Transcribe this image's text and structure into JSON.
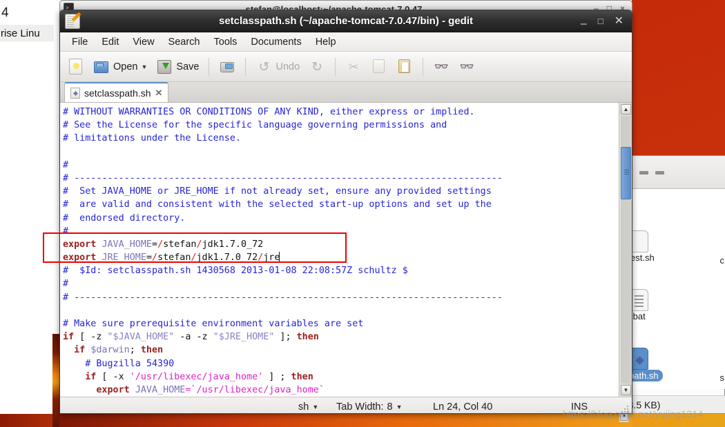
{
  "desktop": {
    "background_window_left": {
      "line1": "4",
      "line2": "rise Linu"
    },
    "terminal_window": {
      "title": "stefan@localhost:~/apache-tomcat-7.0.47",
      "minimize": "–",
      "maximize": "□",
      "close": "×"
    },
    "file_manager": {
      "files": [
        {
          "name": "est.sh",
          "col2": "c",
          "selected": false,
          "icon": "shell-script-file-icon"
        },
        {
          "name": ".bat",
          "col2": "",
          "selected": false,
          "icon": "batch-file-icon"
        },
        {
          "name": "path.sh",
          "col2": "s",
          "selected": true,
          "icon": "shell-script-file-icon"
        }
      ],
      "status": "(3.5 KB)",
      "scroll_down_icon": "chevron-down-icon"
    }
  },
  "window": {
    "title": "setclasspath.sh (~/apache-tomcat-7.0.47/bin) - gedit",
    "app_icon": "gedit-notepad-icon",
    "buttons": {
      "minimize": "–",
      "maximize": "□",
      "close": "✕"
    }
  },
  "menubar": {
    "items": [
      "File",
      "Edit",
      "View",
      "Search",
      "Tools",
      "Documents",
      "Help"
    ]
  },
  "toolbar": {
    "new_label": "",
    "open_label": "Open",
    "open_dropdown_icon": "chevron-down-icon",
    "save_label": "Save",
    "print_label": "",
    "undo_label": "Undo",
    "redo_label": "",
    "cut_label": "",
    "copy_label": "",
    "paste_label": "",
    "find_label": "",
    "replace_label": ""
  },
  "tabs": [
    {
      "label": "setclasspath.sh",
      "close_icon": "close-icon",
      "active": true
    }
  ],
  "editor": {
    "lines": [
      [
        {
          "t": "# WITHOUT WARRANTIES OR CONDITIONS OF ANY KIND, either express or implied.",
          "c": "cmt"
        }
      ],
      [
        {
          "t": "# See the License for the specific language governing permissions and",
          "c": "cmt"
        }
      ],
      [
        {
          "t": "# limitations under the License.",
          "c": "cmt"
        }
      ],
      [
        {
          "t": "",
          "c": "plain"
        }
      ],
      [
        {
          "t": "#",
          "c": "cmt"
        }
      ],
      [
        {
          "t": "# -----------------------------------------------------------------------------",
          "c": "cmt"
        }
      ],
      [
        {
          "t": "#  Set JAVA_HOME or JRE_HOME if not already set, ensure any provided settings",
          "c": "cmt"
        }
      ],
      [
        {
          "t": "#  are valid and consistent with the selected start-up options and set up the",
          "c": "cmt"
        }
      ],
      [
        {
          "t": "#  endorsed directory.",
          "c": "cmt"
        }
      ],
      [
        {
          "t": "#",
          "c": "cmt"
        }
      ],
      [
        {
          "t": "export ",
          "c": "kw"
        },
        {
          "t": "JAVA_HOME",
          "c": "var"
        },
        {
          "t": "=",
          "c": "plain"
        },
        {
          "t": "/",
          "c": "pun"
        },
        {
          "t": "stefan",
          "c": "plain"
        },
        {
          "t": "/",
          "c": "pun"
        },
        {
          "t": "jdk1.7.0_72",
          "c": "plain"
        }
      ],
      [
        {
          "t": "export ",
          "c": "kw"
        },
        {
          "t": "JRE_HOME",
          "c": "var"
        },
        {
          "t": "=",
          "c": "plain"
        },
        {
          "t": "/",
          "c": "pun"
        },
        {
          "t": "stefan",
          "c": "plain"
        },
        {
          "t": "/",
          "c": "pun"
        },
        {
          "t": "jdk1.7.0_72",
          "c": "plain"
        },
        {
          "t": "/",
          "c": "pun"
        },
        {
          "t": "jre",
          "c": "plain"
        },
        {
          "t": "|CARET|",
          "c": "caret"
        }
      ],
      [
        {
          "t": "#  $Id: setclasspath.sh 1430568 2013-01-08 22:08:57Z schultz $",
          "c": "cmt"
        }
      ],
      [
        {
          "t": "#",
          "c": "cmt"
        }
      ],
      [
        {
          "t": "# -----------------------------------------------------------------------------",
          "c": "cmt"
        }
      ],
      [
        {
          "t": "",
          "c": "plain"
        }
      ],
      [
        {
          "t": "# Make sure prerequisite environment variables are set",
          "c": "cmt"
        }
      ],
      [
        {
          "t": "if",
          "c": "kw"
        },
        {
          "t": " [ -z ",
          "c": "plain"
        },
        {
          "t": "\"$JAVA_HOME\"",
          "c": "dstr"
        },
        {
          "t": " -a -z ",
          "c": "plain"
        },
        {
          "t": "\"$JRE_HOME\"",
          "c": "dstr"
        },
        {
          "t": " ]; ",
          "c": "plain"
        },
        {
          "t": "then",
          "c": "kw"
        }
      ],
      [
        {
          "t": "  ",
          "c": "plain"
        },
        {
          "t": "if",
          "c": "kw"
        },
        {
          "t": " ",
          "c": "plain"
        },
        {
          "t": "$darwin",
          "c": "var"
        },
        {
          "t": "; ",
          "c": "plain"
        },
        {
          "t": "then",
          "c": "kw"
        }
      ],
      [
        {
          "t": "    # Bugzilla 54390",
          "c": "cmt"
        }
      ],
      [
        {
          "t": "    ",
          "c": "plain"
        },
        {
          "t": "if",
          "c": "kw"
        },
        {
          "t": " [ -x ",
          "c": "plain"
        },
        {
          "t": "'/usr/libexec/java_home'",
          "c": "str"
        },
        {
          "t": " ] ; ",
          "c": "plain"
        },
        {
          "t": "then",
          "c": "kw"
        }
      ],
      [
        {
          "t": "      ",
          "c": "plain"
        },
        {
          "t": "export",
          "c": "kw"
        },
        {
          "t": " ",
          "c": "plain"
        },
        {
          "t": "JAVA_HOME",
          "c": "var"
        },
        {
          "t": "=`",
          "c": "str"
        },
        {
          "t": "/usr/libexec/java_home",
          "c": "str"
        },
        {
          "t": "`",
          "c": "str"
        }
      ]
    ]
  },
  "scrollbar": {
    "up_icon": "chevron-up-icon",
    "down_icon": "chevron-down-icon",
    "thumb_grip_icon": "grip-lines-icon"
  },
  "statusbar": {
    "language": "sh",
    "language_dropdown_icon": "chevron-down-icon",
    "tab_width_label": "Tab Width:",
    "tab_width_value": "8",
    "tab_width_dropdown_icon": "chevron-down-icon",
    "cursor_position": "Ln 24, Col 40",
    "insert_mode": "INS",
    "resize_grip_icon": "resize-grip-icon"
  },
  "annotation": {
    "highlight_rect_color": "#ee0000"
  },
  "watermark": {
    "text": "https://blog.csdn.net/yujing1314"
  }
}
